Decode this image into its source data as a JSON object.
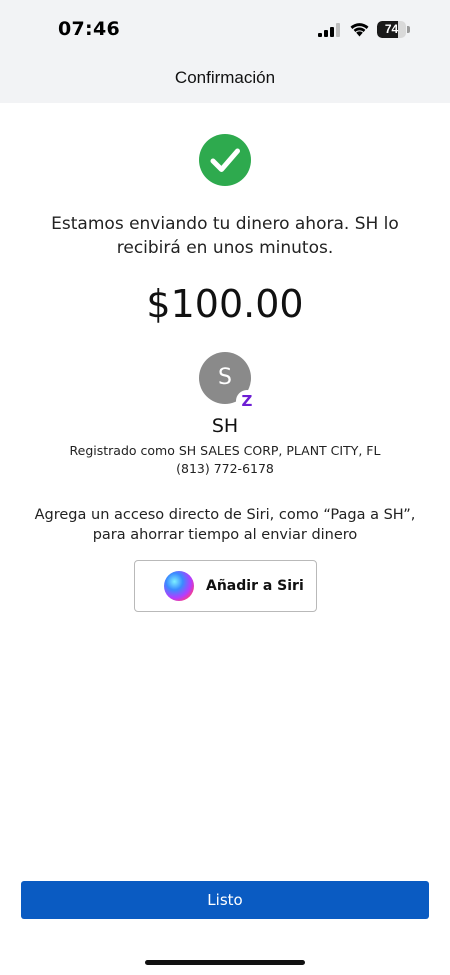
{
  "status_bar": {
    "time": "07:46",
    "battery_level": "74",
    "battery_fraction": 0.74
  },
  "header": {
    "title": "Confirmación"
  },
  "confirmation": {
    "check_icon": "check-circle-icon",
    "check_color": "#2eaa4e",
    "message": "Estamos enviando tu dinero ahora. SH lo recibirá en unos minutos.",
    "amount": "$100.00"
  },
  "recipient": {
    "initial": "S",
    "badge_glyph": "Z",
    "badge_color": "#6d1ed4",
    "name": "SH",
    "registered": "Registrado como SH SALES CORP, PLANT CITY, FL",
    "phone": "(813) 772-6178"
  },
  "siri": {
    "description": "Agrega un acceso directo de Siri, como “Paga a SH”, para ahorrar tiempo al enviar dinero",
    "button_label": "Añadir a Siri",
    "icon": "siri-icon"
  },
  "footer": {
    "done_label": "Listo",
    "done_color": "#0a5bc2"
  }
}
